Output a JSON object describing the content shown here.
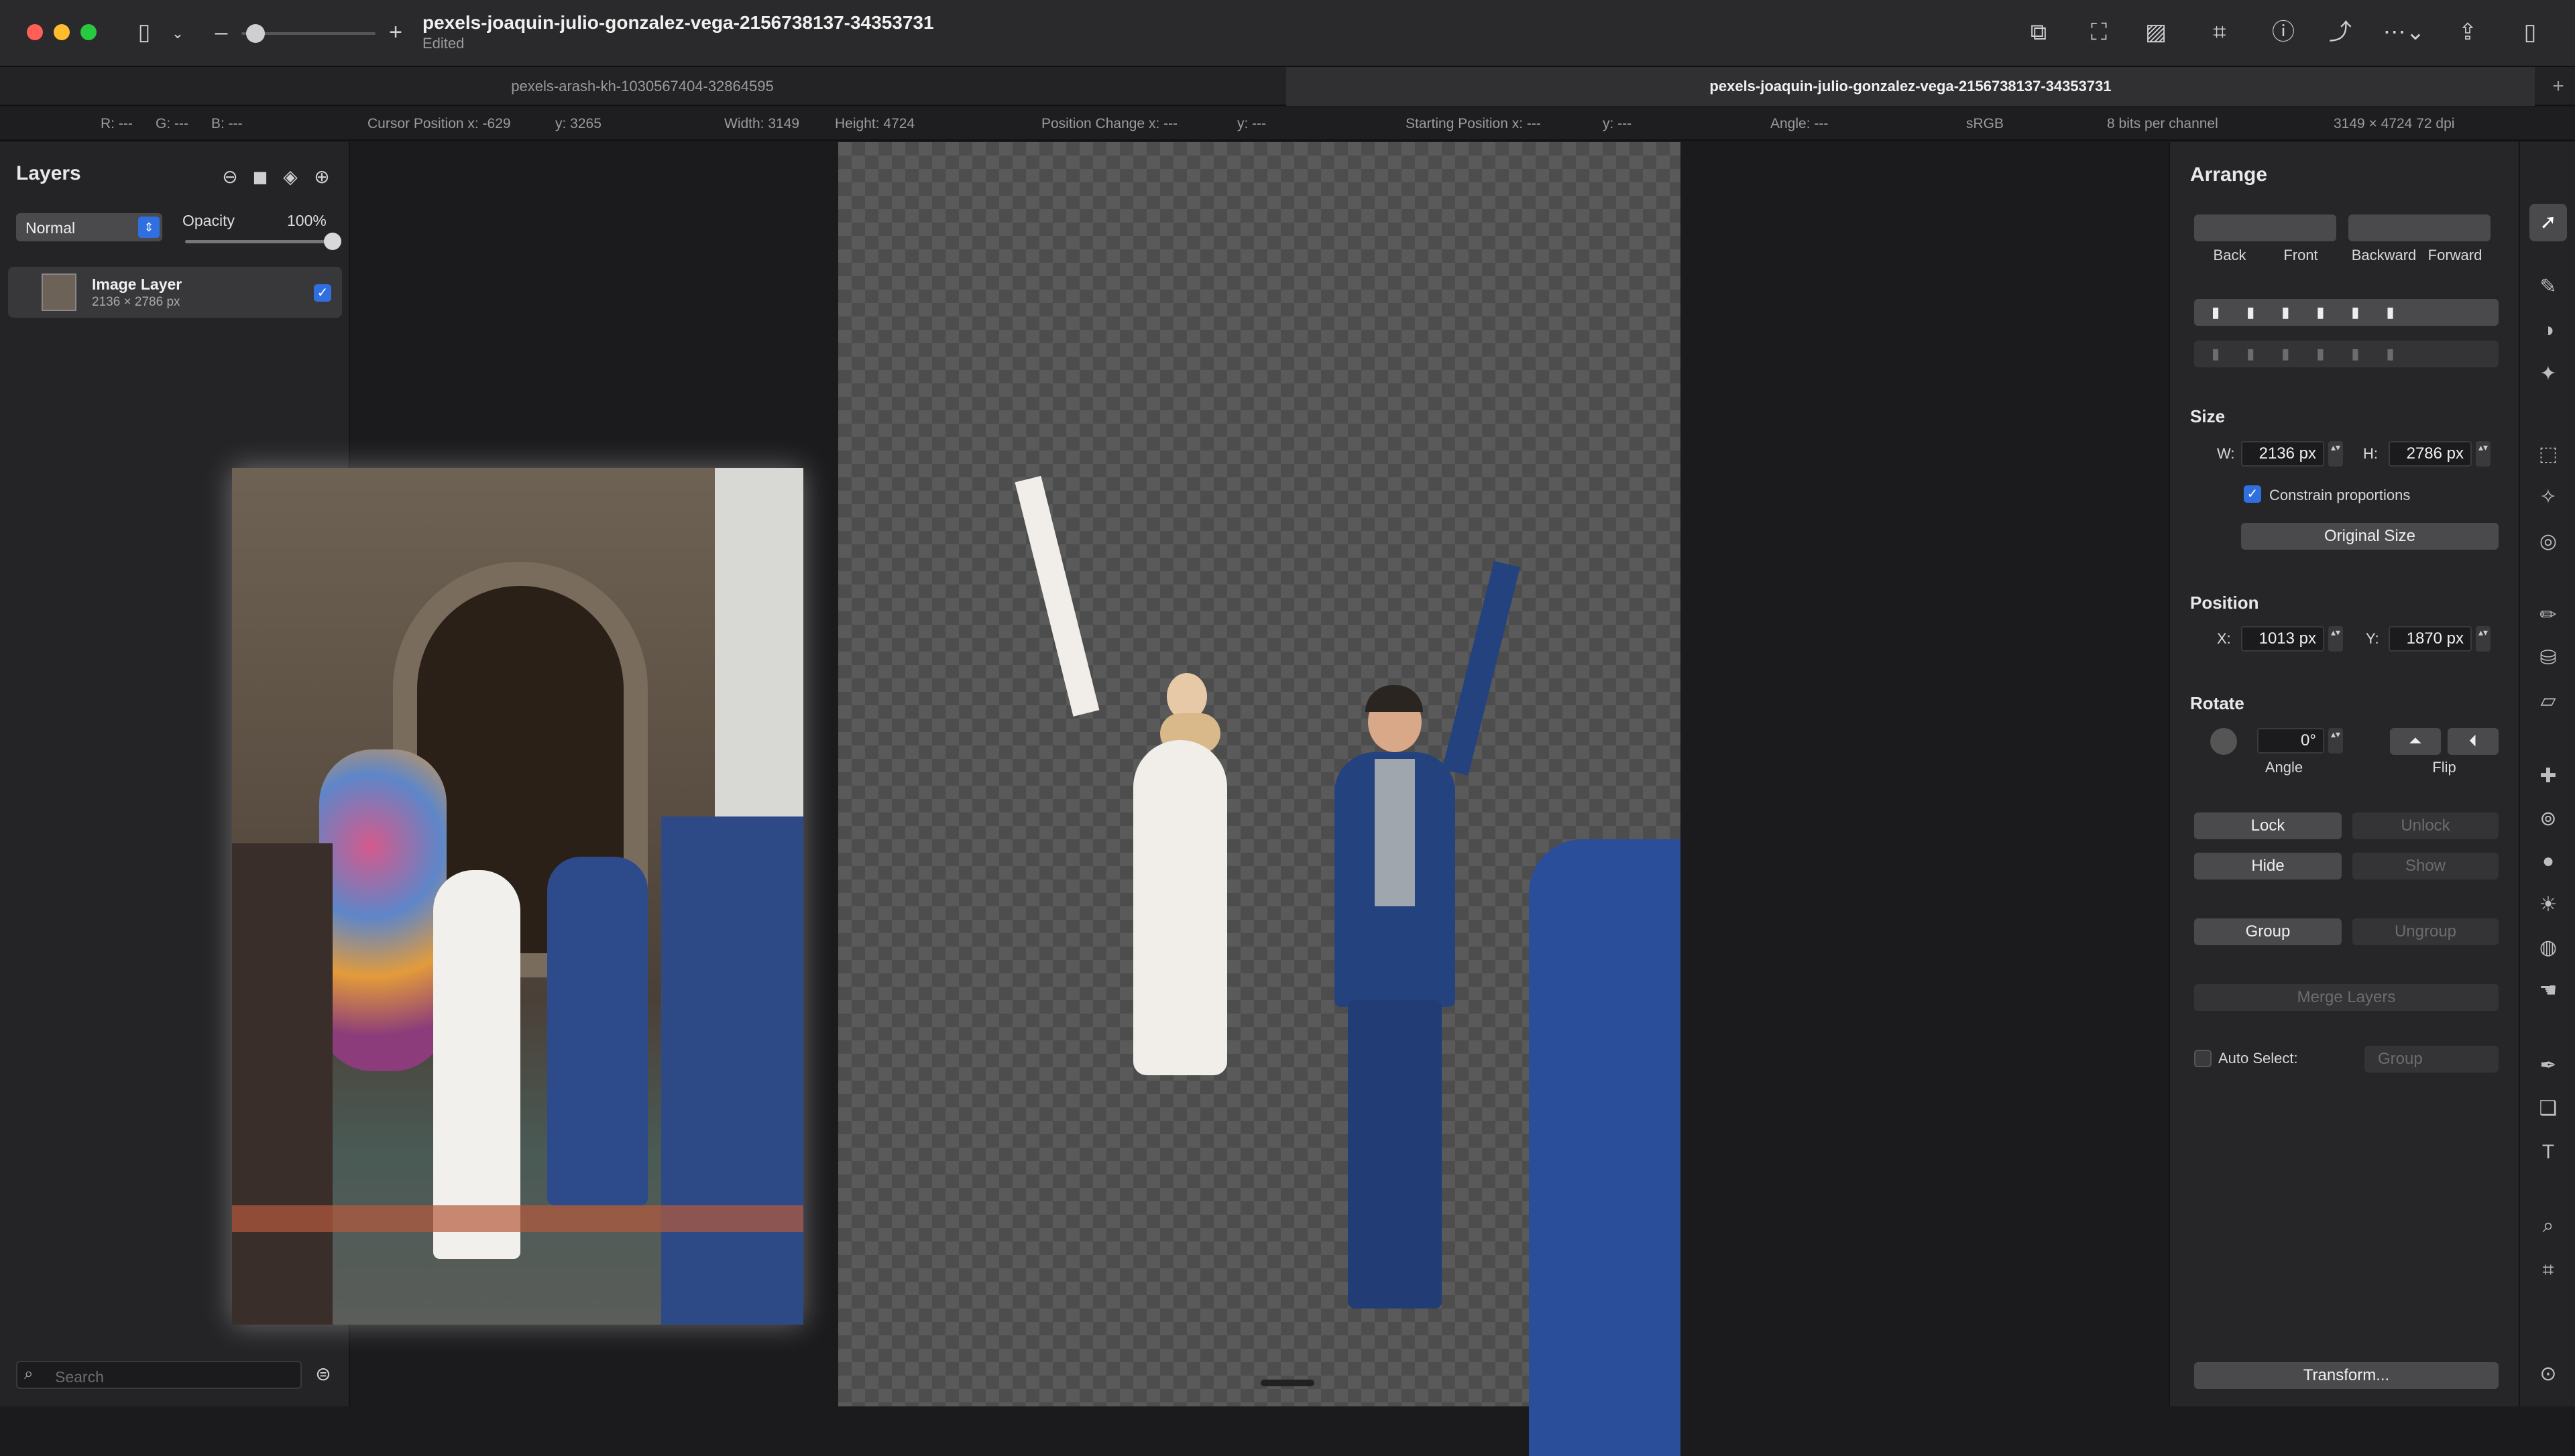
{
  "window": {
    "title": "pexels-joaquin-julio-gonzalez-vega-2156738137-34353731",
    "subtitle": "Edited",
    "zoom_minus": "–",
    "zoom_plus": "+",
    "zoom_level": 0.15
  },
  "tabs": [
    {
      "label": "pexels-arash-kh-1030567404-32864595",
      "active": false
    },
    {
      "label": "pexels-joaquin-julio-gonzalez-vega-2156738137-34353731",
      "active": true
    }
  ],
  "tab_add": "+",
  "infobar": {
    "r": "R: ---",
    "g": "G: ---",
    "b": "B: ---",
    "cursor_x": "Cursor Position x: -629",
    "cursor_y": "y: 3265",
    "width": "Width: 3149",
    "height": "Height: 4724",
    "pos_change_x": "Position Change x: ---",
    "pos_change_y": "y: ---",
    "start_x": "Starting Position x: ---",
    "start_y": "y: ---",
    "angle": "Angle: ---",
    "colorspace": "sRGB",
    "depth": "8 bits per channel",
    "dims": "3149 × 4724 72 dpi"
  },
  "layers_panel": {
    "title": "Layers",
    "blend_mode": "Normal",
    "opacity_label": "Opacity",
    "opacity_value": "100%",
    "opacity_fraction": 1.0,
    "layers": [
      {
        "name": "Image Layer",
        "size": "2136 × 2786 px",
        "visible": true
      }
    ],
    "search_placeholder": "Search"
  },
  "arrange_panel": {
    "title": "Arrange",
    "order_buttons": [
      "Back",
      "Front",
      "Backward",
      "Forward"
    ],
    "size_section": "Size",
    "w_label": "W:",
    "w_value": "2136 px",
    "h_label": "H:",
    "h_value": "2786 px",
    "constrain_label": "Constrain proportions",
    "constrain_checked": true,
    "original_size": "Original Size",
    "position_section": "Position",
    "x_label": "X:",
    "x_value": "1013 px",
    "y_label": "Y:",
    "y_value": "1870 px",
    "rotate_section": "Rotate",
    "angle_value": "0°",
    "angle_label": "Angle",
    "flip_label": "Flip",
    "lock": "Lock",
    "unlock": "Unlock",
    "hide": "Hide",
    "show": "Show",
    "group": "Group",
    "ungroup": "Ungroup",
    "merge": "Merge Layers",
    "auto_select_label": "Auto Select:",
    "auto_select_value": "Group",
    "transform": "Transform..."
  },
  "colors": {
    "accent": "#2f6fe0",
    "close": "#ff5f57",
    "minimize": "#febc2e",
    "zoom": "#28c840"
  }
}
